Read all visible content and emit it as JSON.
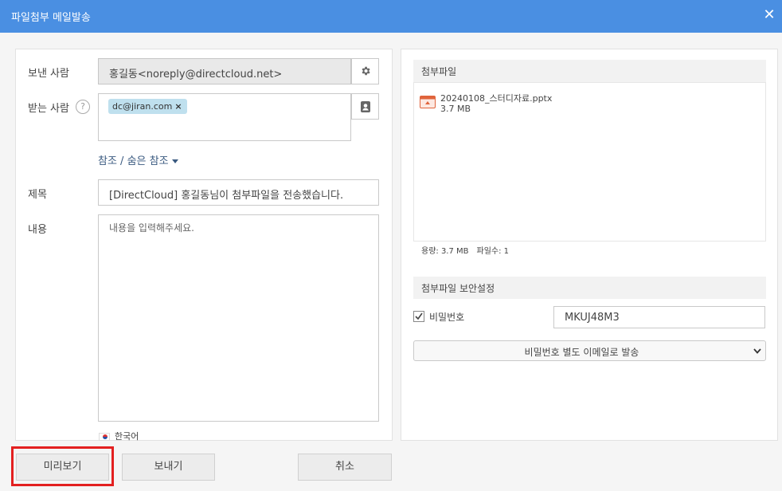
{
  "window": {
    "title": "파일첨부 메일발송",
    "close_label": "✕"
  },
  "form": {
    "from_label": "보낸 사람",
    "from_value": "홍길동<noreply@directcloud.net>",
    "to_label": "받는 사람",
    "help_label": "?",
    "recipients": [
      {
        "email": "dc@jiran.com",
        "remove": "×"
      }
    ],
    "cc_label": "참조 / 숨은 참조",
    "subject_label": "제목",
    "subject_value": "[DirectCloud] 홍길동님이 첨부파일을 전송했습니다.",
    "body_label": "내용",
    "body_placeholder": "내용을 입력해주세요.",
    "language": "한국어"
  },
  "attachments": {
    "header": "첨부파일",
    "files": [
      {
        "name": "20240108_스터디자료.pptx",
        "size": "3.7 MB"
      }
    ],
    "quota_usage": "용량: 3.7 MB",
    "quota_count": "파일수: 1"
  },
  "security": {
    "header": "첨부파일 보안설정",
    "password_checked": true,
    "password_label": "비밀번호",
    "password_value": "MKUJ48M3",
    "delivery_option": "비밀번호 별도 이메일로 발송"
  },
  "buttons": {
    "preview": "미리보기",
    "send": "보내기",
    "cancel": "취소"
  },
  "colors": {
    "titlebar": "#4a8fe2",
    "chip": "#bfe0ee",
    "highlight": "#e32020"
  }
}
